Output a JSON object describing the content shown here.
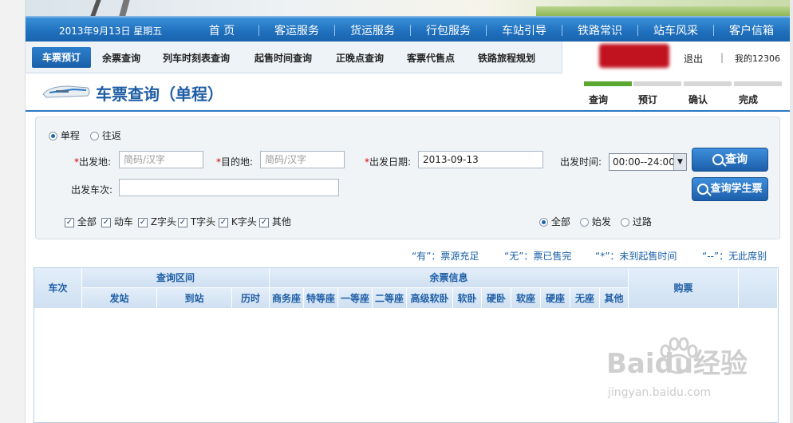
{
  "header": {
    "date": "2013年9月13日 星期五",
    "nav": [
      "首 页",
      "客运服务",
      "货运服务",
      "行包服务",
      "车站引导",
      "铁路常识",
      "站车风采",
      "客户信箱"
    ]
  },
  "subnav": {
    "active": "车票预订",
    "links": [
      "余票查询",
      "列车时刻表查询",
      "起售时间查询",
      "正晚点查询",
      "客票代售点",
      "铁路旅程规划"
    ],
    "logout": "退出",
    "separator": "|",
    "my": "我的12306"
  },
  "page": {
    "title": "车票查询（单程）",
    "steps": [
      "查询",
      "预订",
      "确认",
      "完成"
    ]
  },
  "form": {
    "trip_single": "单程",
    "trip_round": "往返",
    "from_label": "出发地:",
    "from_placeholder": "简码/汉字",
    "to_label": "目的地:",
    "to_placeholder": "简码/汉字",
    "date_label": "出发日期:",
    "date_value": "2013-09-13",
    "time_label": "出发时间:",
    "time_value": "00:00--24:00",
    "train_label": "出发车次:",
    "search_button": "查询",
    "student_button": "查询学生票",
    "train_types": [
      "全部",
      "动车",
      "Z字头",
      "T字头",
      "K字头",
      "其他"
    ],
    "station_filters": [
      "全部",
      "始发",
      "过路"
    ]
  },
  "legend": [
    "“有”：票源充足",
    "“无”：票已售完",
    "“*”：未到起售时间",
    "“--”：无此席别"
  ],
  "table": {
    "col_train": "车次",
    "group_range": "查询区间",
    "group_seats": "余票信息",
    "col_buy": "购票",
    "range_cols": [
      "发站",
      "到站",
      "历时"
    ],
    "seat_cols": [
      "商务座",
      "特等座",
      "一等座",
      "二等座",
      "高级软卧",
      "软卧",
      "硬卧",
      "软座",
      "硬座",
      "无座",
      "其他"
    ]
  },
  "watermark": {
    "logo": "Baidu经验",
    "url": "jingyan.baidu.com"
  }
}
